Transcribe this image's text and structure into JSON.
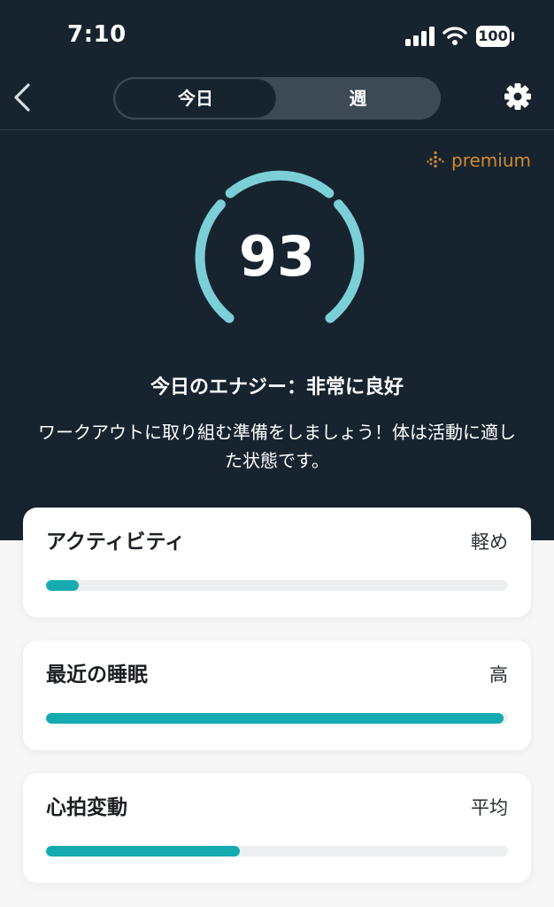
{
  "status_bar": {
    "time": "7:10",
    "battery": "100",
    "icons": [
      "signal-icon",
      "wifi-icon",
      "battery-icon"
    ]
  },
  "nav": {
    "back_icon": "chevron-left-icon",
    "segments": [
      {
        "label": "今日",
        "selected": true
      },
      {
        "label": "週",
        "selected": false
      }
    ],
    "settings_icon": "gear-icon"
  },
  "premium": {
    "label": "premium",
    "icon": "premium-dots-icon",
    "color": "#d08a2c"
  },
  "energy": {
    "score": "93",
    "headline": "今日のエナジー：非常に良好",
    "description": "ワークアウトに取り組む準備をしましょう！体は活動に適した状態です。",
    "gauge_color": "#7ccfd6"
  },
  "metrics": [
    {
      "title": "アクティビティ",
      "value": "軽め",
      "level": 0.07
    },
    {
      "title": "最近の睡眠",
      "value": "高",
      "level": 0.99
    },
    {
      "title": "心拍変動",
      "value": "平均",
      "level": 0.42
    }
  ],
  "colors": {
    "header_bg": "#172430",
    "bar_fill": "#15abb1",
    "bar_track": "#eeeff1",
    "page_bg": "#f7f7f8"
  }
}
